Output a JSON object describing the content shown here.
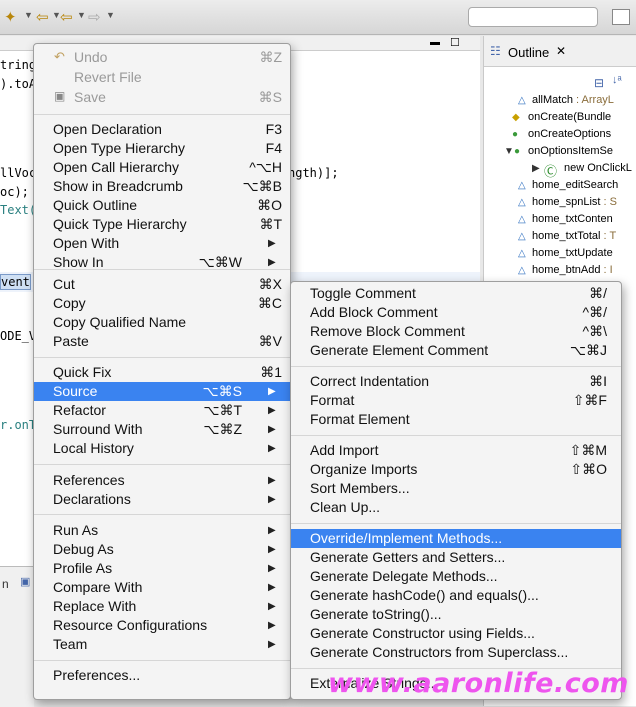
{
  "code_lines": [
    "tring",
    ").toA",
    "llVoc",
    "oc);",
    "Text(",
    "vent",
    "ODE_V",
    "r.onT"
  ],
  "code_length_fragment": "ngth)];",
  "bottom_panel_label": "n",
  "outline": {
    "title": "Outline",
    "close": "✕",
    "items": [
      {
        "name": "allMatch",
        "type": " : ArrayL"
      },
      {
        "name": "onCreate(Bundle",
        "type": ""
      },
      {
        "name": "onCreateOptions",
        "type": ""
      },
      {
        "name": "onOptionsItemSe",
        "type": ""
      },
      {
        "name": "new OnClickL",
        "type": ""
      },
      {
        "name": "home_editSearch",
        "type": ""
      },
      {
        "name": "home_spnList",
        "type": " : S"
      },
      {
        "name": "home_txtConten",
        "type": ""
      },
      {
        "name": "home_txtTotal",
        "type": " : T"
      },
      {
        "name": "home_txtUpdate",
        "type": ""
      },
      {
        "name": "home_btnAdd",
        "type": " : I"
      }
    ]
  },
  "context_menu": {
    "items": [
      {
        "label": "Undo",
        "shortcut": "⌘Z",
        "disabled": true
      },
      {
        "label": "Revert File",
        "shortcut": "",
        "disabled": true
      },
      {
        "label": "Save",
        "shortcut": "⌘S",
        "disabled": true
      },
      {
        "label": "Open Declaration",
        "shortcut": "F3"
      },
      {
        "label": "Open Type Hierarchy",
        "shortcut": "F4"
      },
      {
        "label": "Open Call Hierarchy",
        "shortcut": "^⌥H"
      },
      {
        "label": "Show in Breadcrumb",
        "shortcut": "⌥⌘B"
      },
      {
        "label": "Quick Outline",
        "shortcut": "⌘O"
      },
      {
        "label": "Quick Type Hierarchy",
        "shortcut": "⌘T"
      },
      {
        "label": "Open With",
        "shortcut": ""
      },
      {
        "label": "Show In",
        "shortcut": "⌥⌘W"
      },
      {
        "label": "Cut",
        "shortcut": "⌘X"
      },
      {
        "label": "Copy",
        "shortcut": "⌘C"
      },
      {
        "label": "Copy Qualified Name",
        "shortcut": ""
      },
      {
        "label": "Paste",
        "shortcut": "⌘V"
      },
      {
        "label": "Quick Fix",
        "shortcut": "⌘1"
      },
      {
        "label": "Source",
        "shortcut": "⌥⌘S"
      },
      {
        "label": "Refactor",
        "shortcut": "⌥⌘T"
      },
      {
        "label": "Surround With",
        "shortcut": "⌥⌘Z"
      },
      {
        "label": "Local History",
        "shortcut": ""
      },
      {
        "label": "References",
        "shortcut": ""
      },
      {
        "label": "Declarations",
        "shortcut": ""
      },
      {
        "label": "Run As",
        "shortcut": ""
      },
      {
        "label": "Debug As",
        "shortcut": ""
      },
      {
        "label": "Profile As",
        "shortcut": ""
      },
      {
        "label": "Compare With",
        "shortcut": ""
      },
      {
        "label": "Replace With",
        "shortcut": ""
      },
      {
        "label": "Resource Configurations",
        "shortcut": ""
      },
      {
        "label": "Team",
        "shortcut": ""
      },
      {
        "label": "Preferences...",
        "shortcut": ""
      }
    ]
  },
  "source_submenu": {
    "items": [
      {
        "label": "Toggle Comment",
        "shortcut": "⌘/"
      },
      {
        "label": "Add Block Comment",
        "shortcut": "^⌘/"
      },
      {
        "label": "Remove Block Comment",
        "shortcut": "^⌘\\"
      },
      {
        "label": "Generate Element Comment",
        "shortcut": "⌥⌘J"
      },
      {
        "label": "Correct Indentation",
        "shortcut": "⌘I"
      },
      {
        "label": "Format",
        "shortcut": "⇧⌘F"
      },
      {
        "label": "Format Element",
        "shortcut": ""
      },
      {
        "label": "Add Import",
        "shortcut": "⇧⌘M"
      },
      {
        "label": "Organize Imports",
        "shortcut": "⇧⌘O"
      },
      {
        "label": "Sort Members...",
        "shortcut": ""
      },
      {
        "label": "Clean Up...",
        "shortcut": ""
      },
      {
        "label": "Override/Implement Methods...",
        "shortcut": ""
      },
      {
        "label": "Generate Getters and Setters...",
        "shortcut": ""
      },
      {
        "label": "Generate Delegate Methods...",
        "shortcut": ""
      },
      {
        "label": "Generate hashCode() and equals()...",
        "shortcut": ""
      },
      {
        "label": "Generate toString()...",
        "shortcut": ""
      },
      {
        "label": "Generate Constructor using Fields...",
        "shortcut": ""
      },
      {
        "label": "Generate Constructors from Superclass...",
        "shortcut": ""
      },
      {
        "label": "Externalize Strings...",
        "shortcut": ""
      }
    ]
  },
  "watermark": "www.aaronlife.com",
  "colors": {
    "selection": "#3a83f0",
    "watermark": "#ee55ee"
  }
}
